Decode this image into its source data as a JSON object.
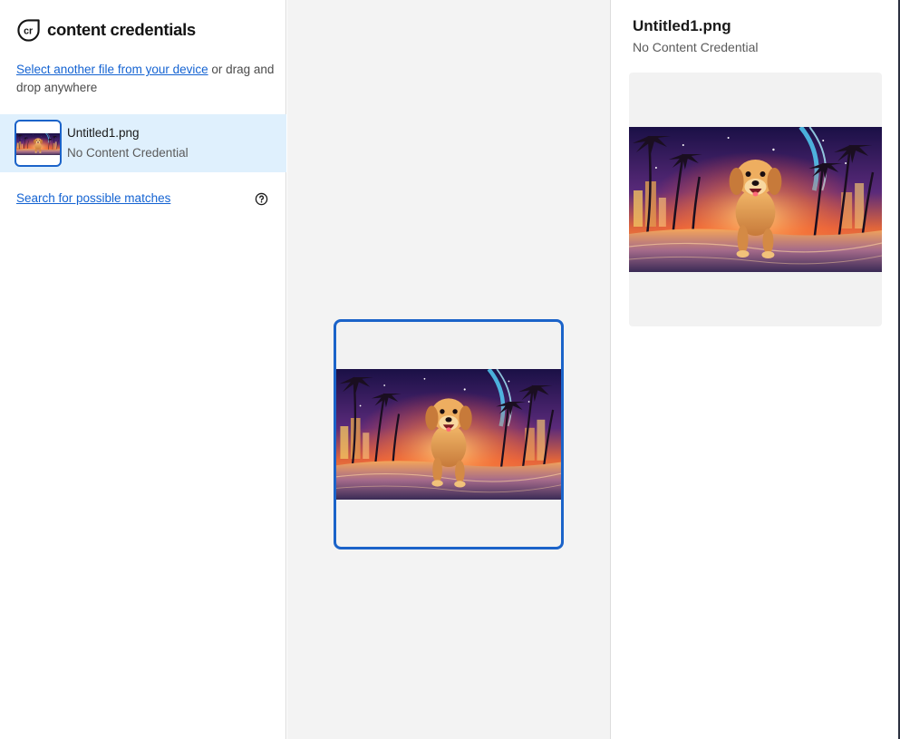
{
  "brand": {
    "name": "content credentials",
    "logo_icon": "cr-logo-icon"
  },
  "upload": {
    "link_text": "Select another file from your device",
    "suffix_text": " or drag and drop anywhere"
  },
  "file_list": [
    {
      "name": "Untitled1.png",
      "status": "No Content Credential"
    }
  ],
  "search": {
    "link_text": "Search for possible matches",
    "help_icon": "question-circle-icon"
  },
  "detail": {
    "title": "Untitled1.png",
    "status": "No Content Credential"
  },
  "colors": {
    "accent": "#1b63c9",
    "link": "#1463d2",
    "selected_bg": "#dff0fd",
    "canvas_bg": "#f3f3f3"
  }
}
